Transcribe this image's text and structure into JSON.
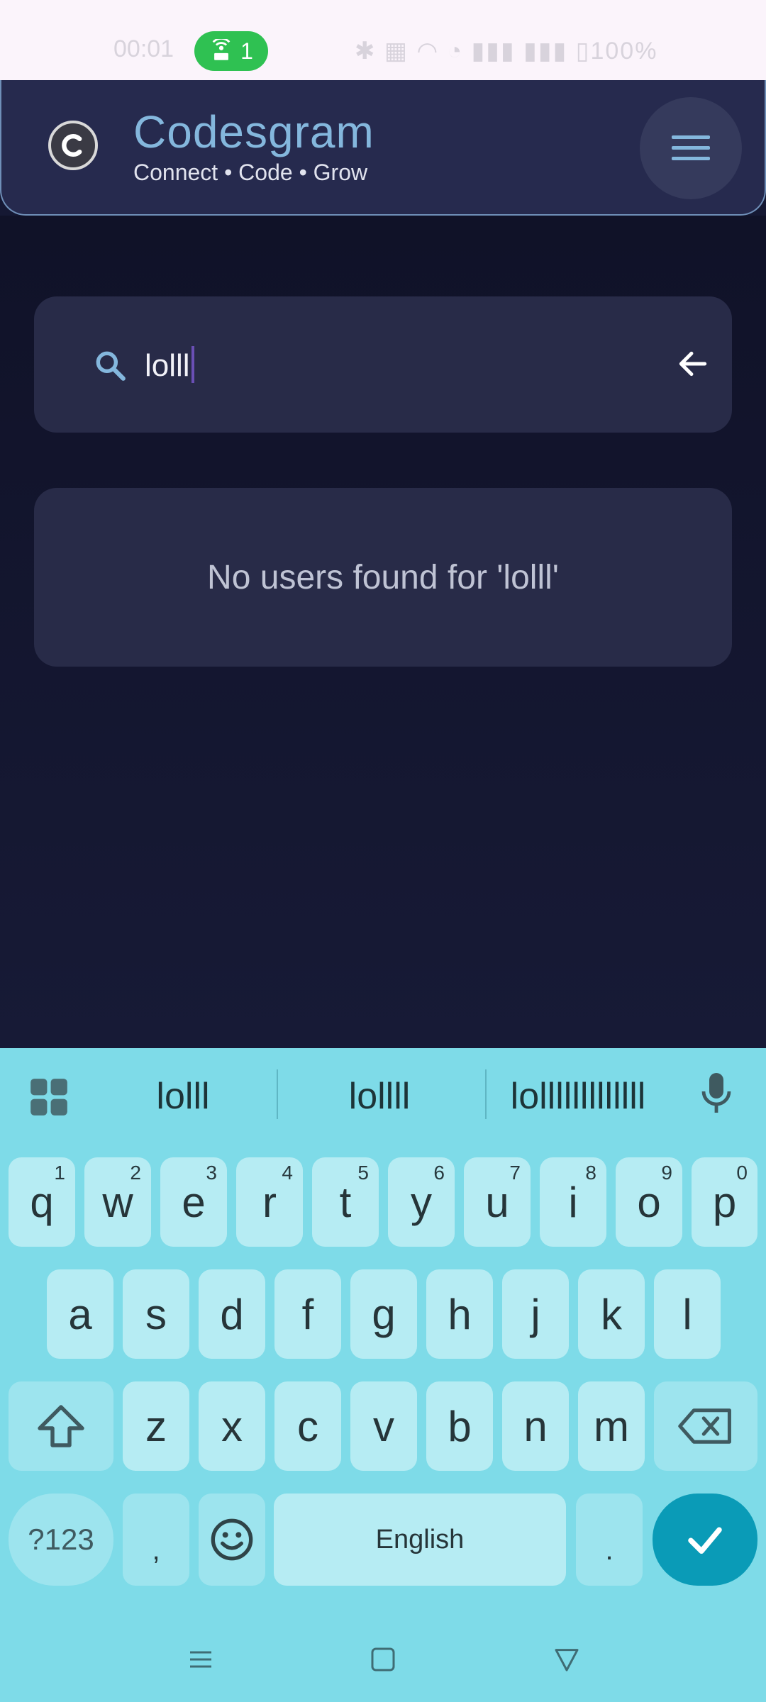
{
  "status_bar": {
    "time": "00:01",
    "hotspot_count": "1",
    "battery": "100%"
  },
  "header": {
    "app_name": "Codesgram",
    "tagline": "Connect • Code • Grow",
    "logo_letter": "C"
  },
  "search": {
    "query": "lolll",
    "icon": "search-icon",
    "back_icon": "arrow-left-icon"
  },
  "results": {
    "empty_message": "No users found for 'lolll'"
  },
  "keyboard": {
    "suggestions": [
      "lolll",
      "lollll",
      "lolllllllllllll"
    ],
    "row1": [
      {
        "key": "q",
        "hint": "1"
      },
      {
        "key": "w",
        "hint": "2"
      },
      {
        "key": "e",
        "hint": "3"
      },
      {
        "key": "r",
        "hint": "4"
      },
      {
        "key": "t",
        "hint": "5"
      },
      {
        "key": "y",
        "hint": "6"
      },
      {
        "key": "u",
        "hint": "7"
      },
      {
        "key": "i",
        "hint": "8"
      },
      {
        "key": "o",
        "hint": "9"
      },
      {
        "key": "p",
        "hint": "0"
      }
    ],
    "row2": [
      "a",
      "s",
      "d",
      "f",
      "g",
      "h",
      "j",
      "k",
      "l"
    ],
    "row3": [
      "z",
      "x",
      "c",
      "v",
      "b",
      "n",
      "m"
    ],
    "symbols_label": "?123",
    "comma_label": ",",
    "space_label": "English",
    "period_label": ".",
    "colors": {
      "background": "#7edbe8",
      "key": "#b6ecf3",
      "enter": "#0a9bb7"
    }
  },
  "theme": {
    "accent": "#84b7dd",
    "surface": "#282b48",
    "background": "#151833"
  }
}
